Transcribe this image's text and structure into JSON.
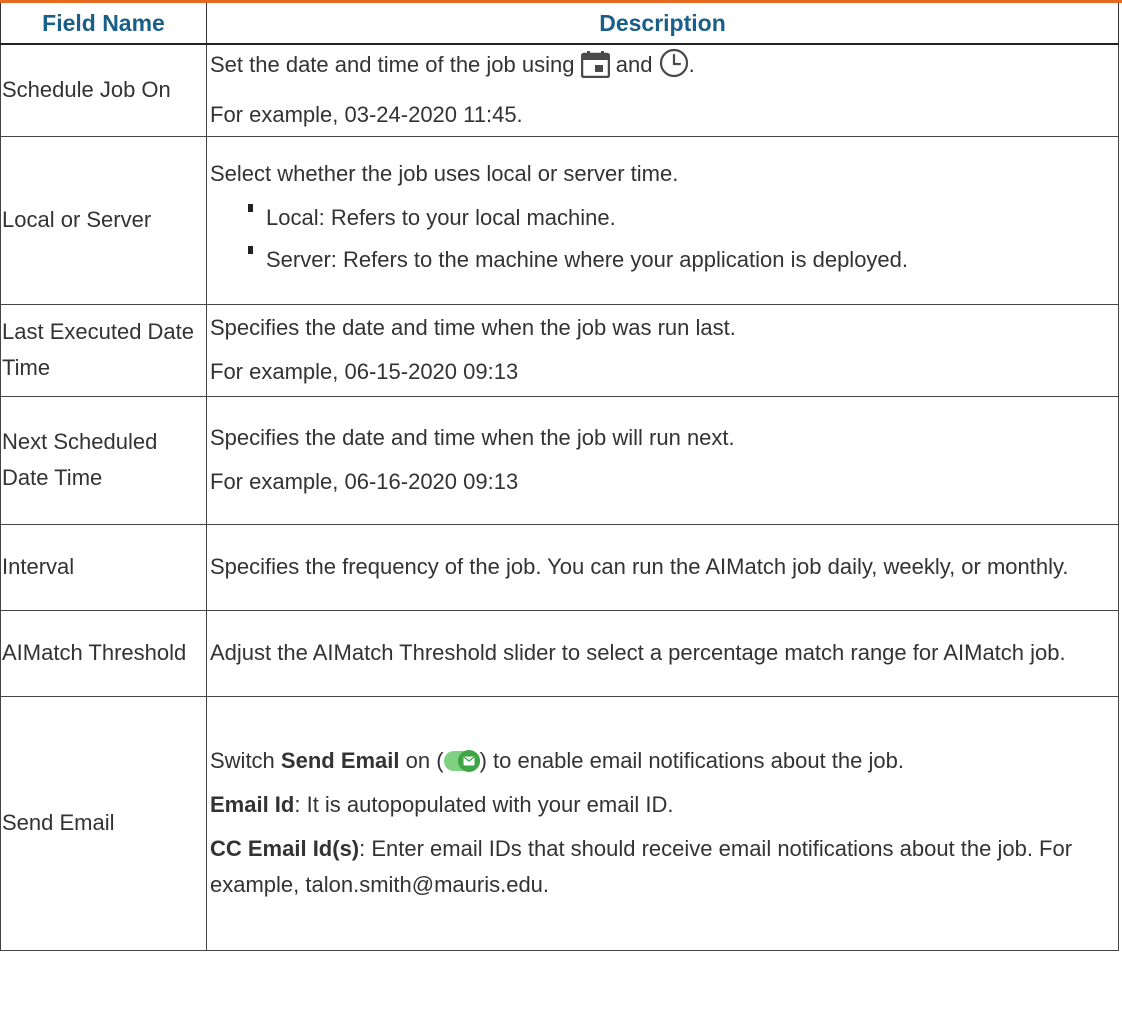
{
  "header": {
    "col1": "Field Name",
    "col2": "Description"
  },
  "rows": [
    {
      "name": "Schedule Job On",
      "desc_line1_before": "Set the date and time of the job using",
      "icon1": "calendar-icon",
      "desc_line1_mid": "and",
      "icon2": "clock-icon",
      "desc_line1_after": ".",
      "desc_line2": "For example, 03-24-2020 11:45."
    },
    {
      "name": "Local or Server",
      "desc_intro": "Select whether the job uses local or server time.",
      "bullets": [
        "Local: Refers to your local machine.",
        "Server: Refers to the machine where your application is deployed."
      ]
    },
    {
      "name": "Last Executed Date Time",
      "desc_line1": "Specifies the date and time when the job was run last.",
      "desc_line2": "For example, 06-15-2020 09:13"
    },
    {
      "name": "Next Scheduled Date Time",
      "desc_line1": "Specifies the date and time when the job will run next.",
      "desc_line2": "For example, 06-16-2020 09:13"
    },
    {
      "name": "Interval",
      "desc": "Specifies the frequency of the job. You can run the AIMatch job daily, weekly, or monthly."
    },
    {
      "name": "AIMatch Threshold",
      "desc": "Adjust the AIMatch Threshold slider to select a percentage match range for AIMatch job."
    },
    {
      "name": "Send Email",
      "p1_before": "Switch",
      "p1_bold": "Send Email",
      "p1_mid": "on (",
      "toggle_icon": "toggle-on-email-icon",
      "p1_after": ") to enable email notifications about the job.",
      "p2_bold": "Email Id",
      "p2_rest": ": It is autopopulated with your email ID.",
      "p3_bold": "CC Email Id(s)",
      "p3_rest": ": Enter email IDs that should receive email notifications about the job. For example, talon.smith@mauris.edu."
    }
  ],
  "colors": {
    "header_text": "#1a5f8a",
    "top_rule": "#e56a1f",
    "toggle_track": "#7fd081",
    "toggle_knob": "#3ea544",
    "icon_fill": "#4a4a4a"
  }
}
